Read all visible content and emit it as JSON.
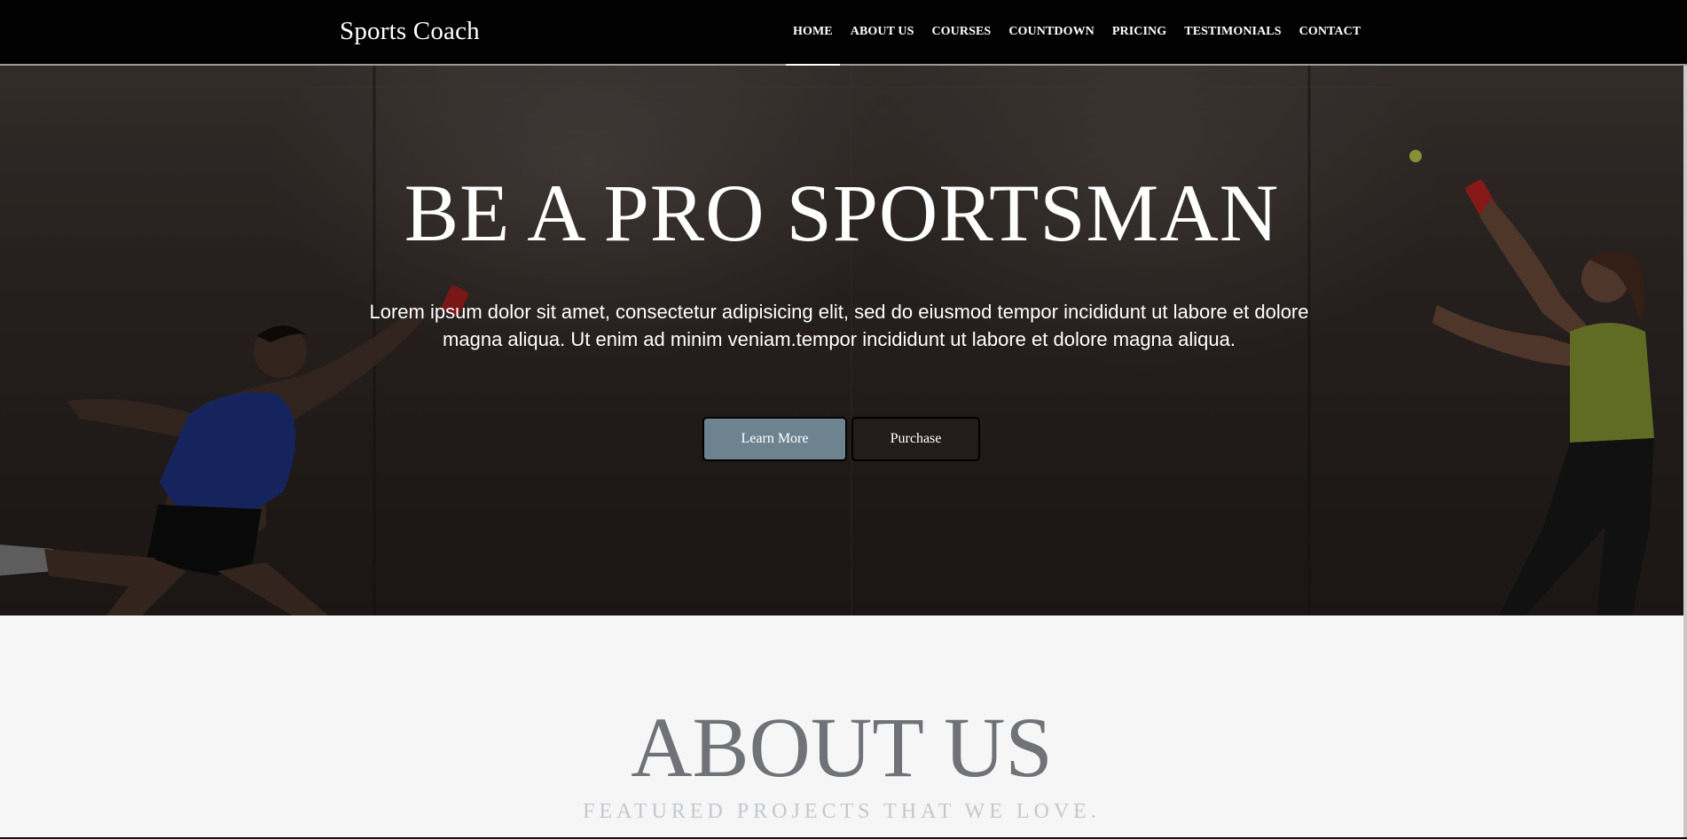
{
  "navbar": {
    "brand": "Sports Coach",
    "items": [
      {
        "label": "HOME",
        "active": true
      },
      {
        "label": "ABOUT US",
        "active": false
      },
      {
        "label": "COURSES",
        "active": false
      },
      {
        "label": "COUNTDOWN",
        "active": false
      },
      {
        "label": "PRICING",
        "active": false
      },
      {
        "label": "TESTIMONIALS",
        "active": false
      },
      {
        "label": "CONTACT",
        "active": false
      }
    ]
  },
  "hero": {
    "title": "BE A PRO SPORTSMAN",
    "text": "Lorem ipsum dolor sit amet, consectetur adipisicing elit, sed do eiusmod tempor incididunt ut labore et dolore magna aliqua. Ut enim ad minim veniam.tempor incididunt ut labore et dolore magna aliqua.",
    "learn_more_label": "Learn More",
    "purchase_label": "Purchase"
  },
  "about": {
    "title": "ABOUT US",
    "subtitle": "FEATURED PROJECTS THAT WE LOVE."
  },
  "colors": {
    "navbar_bg": "#020202",
    "learn_more_bg": "#6d8490",
    "purchase_bg": "#221c1a",
    "about_title": "#6f7377",
    "about_subtitle": "#c4c8cc"
  }
}
